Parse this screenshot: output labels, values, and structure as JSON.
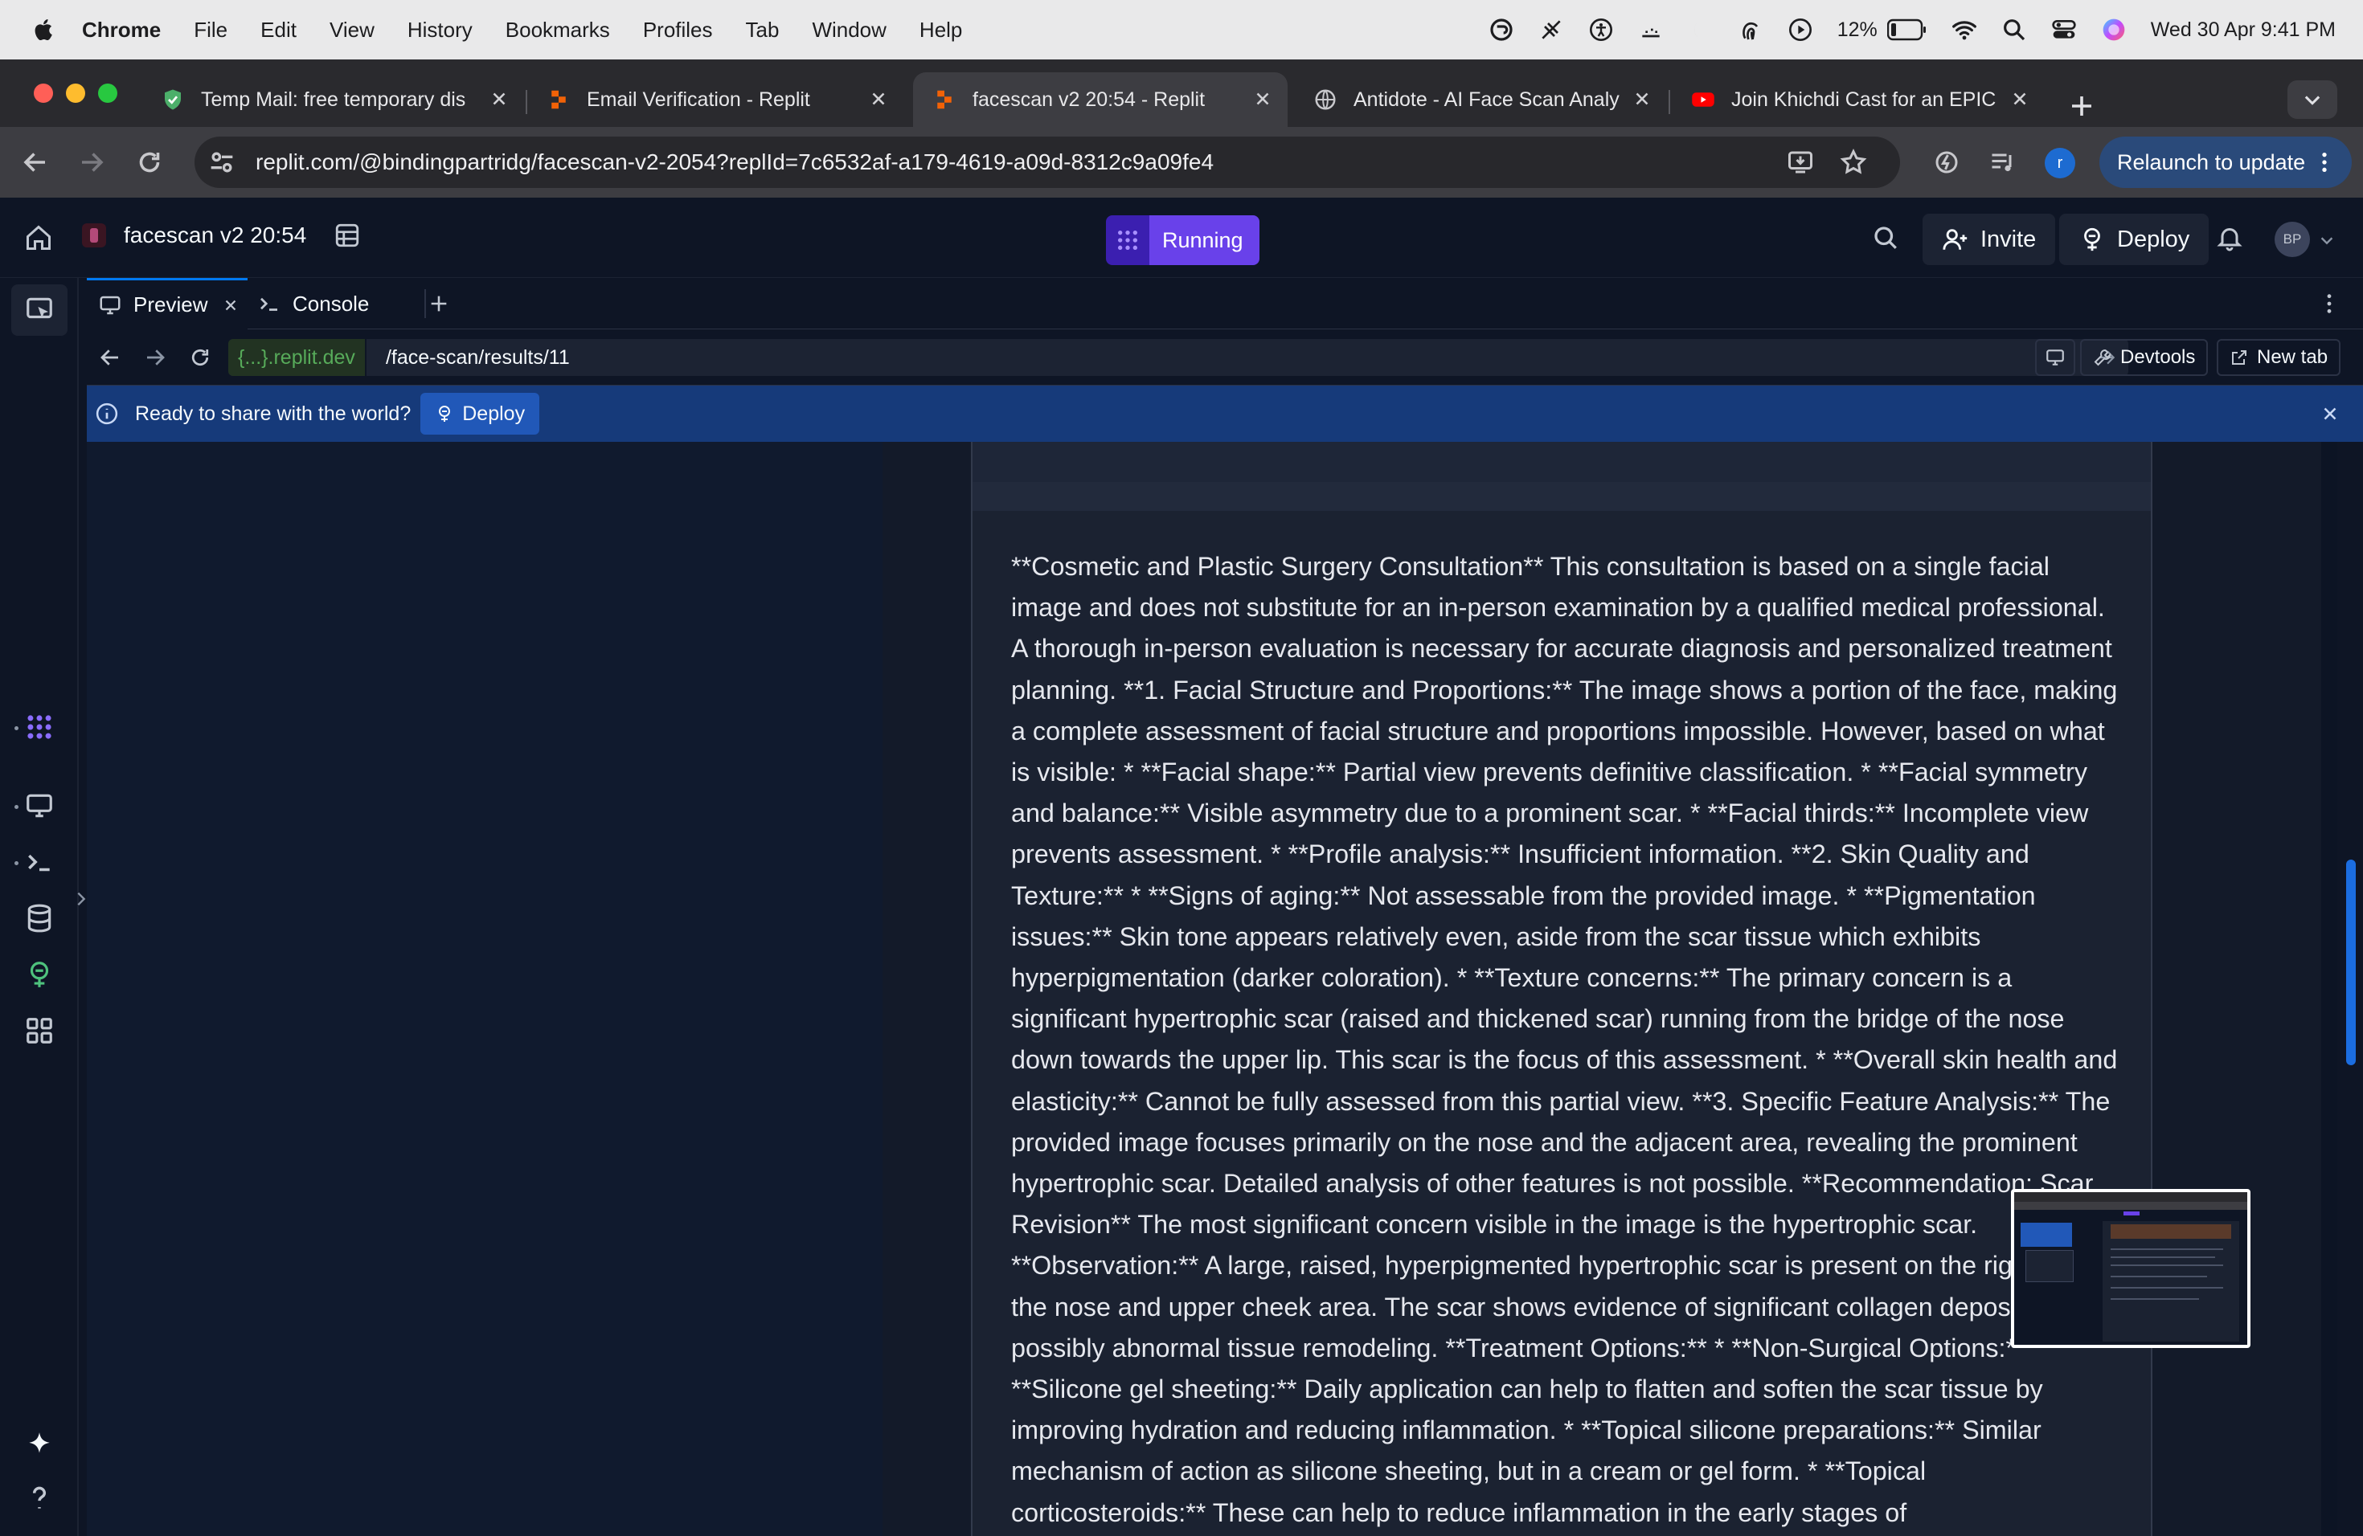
{
  "menubar": {
    "app": "Chrome",
    "items": [
      "File",
      "Edit",
      "View",
      "History",
      "Bookmarks",
      "Profiles",
      "Tab",
      "Window",
      "Help"
    ],
    "battery": "12%",
    "datetime": "Wed 30 Apr  9:41 PM"
  },
  "tabs": [
    {
      "title": "Temp Mail: free temporary dis",
      "icon": "shield-icon",
      "active": false
    },
    {
      "title": "Email Verification - Replit",
      "icon": "replit-icon",
      "active": false
    },
    {
      "title": "facescan v2 20:54 - Replit",
      "icon": "replit-icon",
      "active": true
    },
    {
      "title": "Antidote - AI Face Scan Analy",
      "icon": "globe-icon",
      "active": false
    },
    {
      "title": "Join Khichdi Cast for an EPIC",
      "icon": "youtube-icon",
      "active": false
    }
  ],
  "toolbar": {
    "url": "replit.com/@bindingpartridg/facescan-v2-2054?replId=7c6532af-a179-4619-a09d-8312c9a09fe4",
    "relaunch": "Relaunch to update",
    "profile_initial": "r"
  },
  "header": {
    "repl_name": "facescan v2 20:54",
    "status": "Running",
    "invite": "Invite",
    "deploy": "Deploy",
    "avatar": "BP"
  },
  "panes": {
    "preview_tab": "Preview",
    "console_tab": "Console"
  },
  "preview": {
    "domain": "{...}.replit.dev",
    "path": "/face-scan/results/11",
    "devtools": "Devtools",
    "new_tab": "New tab"
  },
  "banner": {
    "text": "Ready to share with the world?",
    "deploy": "Deploy"
  },
  "report": {
    "text": "**Cosmetic and Plastic Surgery Consultation** This consultation is based on a single facial image and does not substitute for an in-person examination by a qualified medical professional. A thorough in-person evaluation is necessary for accurate diagnosis and personalized treatment planning. **1. Facial Structure and Proportions:** The image shows a portion of the face, making a complete assessment of facial structure and proportions impossible. However, based on what is visible: * **Facial shape:** Partial view prevents definitive classification. * **Facial symmetry and balance:** Visible asymmetry due to a prominent scar. * **Facial thirds:** Incomplete view prevents assessment. * **Profile analysis:** Insufficient information. **2. Skin Quality and Texture:** * **Signs of aging:** Not assessable from the provided image. * **Pigmentation issues:** Skin tone appears relatively even, aside from the scar tissue which exhibits hyperpigmentation (darker coloration). * **Texture concerns:** The primary concern is a significant hypertrophic scar (raised and thickened scar) running from the bridge of the nose down towards the upper lip. This scar is the focus of this assessment. * **Overall skin health and elasticity:** Cannot be fully assessed from this partial view. **3. Specific Feature Analysis:** The provided image focuses primarily on the nose and the adjacent area, revealing the prominent hypertrophic scar. Detailed analysis of other features is not possible. **Recommendation: Scar Revision** The most significant concern visible in the image is the hypertrophic scar. **Observation:** A large, raised, hyperpigmented hypertrophic scar is present on the right side of the nose and upper cheek area. The scar shows evidence of significant collagen deposition and possibly abnormal tissue remodeling. **Treatment Options:** * **Non-Surgical Options:** * **Silicone gel sheeting:** Daily application can help to flatten and soften the scar tissue by improving hydration and reducing inflammation. * **Topical silicone preparations:** Similar mechanism of action as silicone sheeting, but in a cream or gel form. * **Topical corticosteroids:** These can help to reduce inflammation in the early stages of"
  },
  "colors": {
    "accent_blue": "#0079f2",
    "running_purple": "#6941ea",
    "banner_blue": "#163a7a"
  }
}
